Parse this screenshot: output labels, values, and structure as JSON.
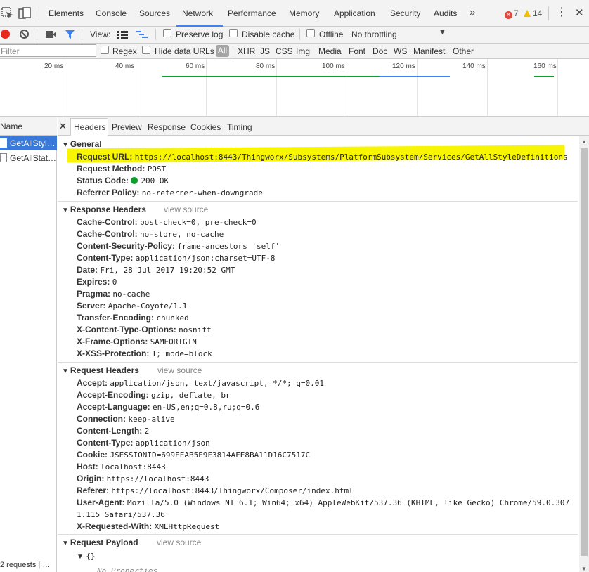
{
  "topbar": {
    "tabs": [
      "Elements",
      "Console",
      "Sources",
      "Network",
      "Performance",
      "Memory",
      "Application",
      "Security",
      "Audits"
    ],
    "more": "»",
    "errors": "7",
    "warnings": "14"
  },
  "toolbar": {
    "view_label": "View:",
    "preserve_log": "Preserve log",
    "disable_cache": "Disable cache",
    "offline": "Offline",
    "throttling": "No throttling"
  },
  "filterbar": {
    "filter_placeholder": "Filter",
    "regex": "Regex",
    "hide_data_urls": "Hide data URLs",
    "types": [
      "All",
      "XHR",
      "JS",
      "CSS",
      "Img",
      "Media",
      "Font",
      "Doc",
      "WS",
      "Manifest",
      "Other"
    ]
  },
  "overview": {
    "ticks": [
      "20 ms",
      "40 ms",
      "60 ms",
      "80 ms",
      "100 ms",
      "120 ms",
      "140 ms",
      "160 ms"
    ]
  },
  "requests": {
    "header": "Name",
    "items": [
      "GetAllStyl…",
      "GetAllStat…"
    ],
    "footer": "2 requests | …"
  },
  "detail": {
    "tabs": [
      "Headers",
      "Preview",
      "Response",
      "Cookies",
      "Timing"
    ],
    "general": {
      "title": "General",
      "rows": [
        {
          "k": "Request URL:",
          "v": "https://localhost:8443/Thingworx/Subsystems/PlatformSubsystem/Services/GetAllStyleDefinitions"
        },
        {
          "k": "Request Method:",
          "v": "POST"
        },
        {
          "k": "Status Code:",
          "v": "200 OK"
        },
        {
          "k": "Referrer Policy:",
          "v": "no-referrer-when-downgrade"
        }
      ]
    },
    "response_headers": {
      "title": "Response Headers",
      "view_source": "view source",
      "rows": [
        {
          "k": "Cache-Control:",
          "v": "post-check=0, pre-check=0"
        },
        {
          "k": "Cache-Control:",
          "v": "no-store, no-cache"
        },
        {
          "k": "Content-Security-Policy:",
          "v": "frame-ancestors 'self'"
        },
        {
          "k": "Content-Type:",
          "v": "application/json;charset=UTF-8"
        },
        {
          "k": "Date:",
          "v": "Fri, 28 Jul 2017 19:20:52 GMT"
        },
        {
          "k": "Expires:",
          "v": "0"
        },
        {
          "k": "Pragma:",
          "v": "no-cache"
        },
        {
          "k": "Server:",
          "v": "Apache-Coyote/1.1"
        },
        {
          "k": "Transfer-Encoding:",
          "v": "chunked"
        },
        {
          "k": "X-Content-Type-Options:",
          "v": "nosniff"
        },
        {
          "k": "X-Frame-Options:",
          "v": "SAMEORIGIN"
        },
        {
          "k": "X-XSS-Protection:",
          "v": "1; mode=block"
        }
      ]
    },
    "request_headers": {
      "title": "Request Headers",
      "view_source": "view source",
      "rows": [
        {
          "k": "Accept:",
          "v": "application/json, text/javascript, */*; q=0.01"
        },
        {
          "k": "Accept-Encoding:",
          "v": "gzip, deflate, br"
        },
        {
          "k": "Accept-Language:",
          "v": "en-US,en;q=0.8,ru;q=0.6"
        },
        {
          "k": "Connection:",
          "v": "keep-alive"
        },
        {
          "k": "Content-Length:",
          "v": "2"
        },
        {
          "k": "Content-Type:",
          "v": "application/json"
        },
        {
          "k": "Cookie:",
          "v": "JSESSIONID=699EEAB5E9F3814AFE8BA11D16C7517C"
        },
        {
          "k": "Host:",
          "v": "localhost:8443"
        },
        {
          "k": "Origin:",
          "v": "https://localhost:8443"
        },
        {
          "k": "Referer:",
          "v": "https://localhost:8443/Thingworx/Composer/index.html"
        },
        {
          "k": "User-Agent:",
          "v": "Mozilla/5.0 (Windows NT 6.1; Win64; x64) AppleWebKit/537.36 (KHTML, like Gecko) Chrome/59.0.307"
        },
        {
          "k": "",
          "v": "1.115 Safari/537.36"
        },
        {
          "k": "X-Requested-With:",
          "v": "XMLHttpRequest"
        }
      ]
    },
    "request_payload": {
      "title": "Request Payload",
      "view_source": "view source",
      "tree_root": "{}",
      "empty": "No Properties"
    }
  },
  "colors": {
    "accent": "#3e82f7",
    "selected_row": "#3879d9",
    "highlight": "#f7f500",
    "status_ok": "#0e9e2c",
    "record": "#e8281a"
  }
}
